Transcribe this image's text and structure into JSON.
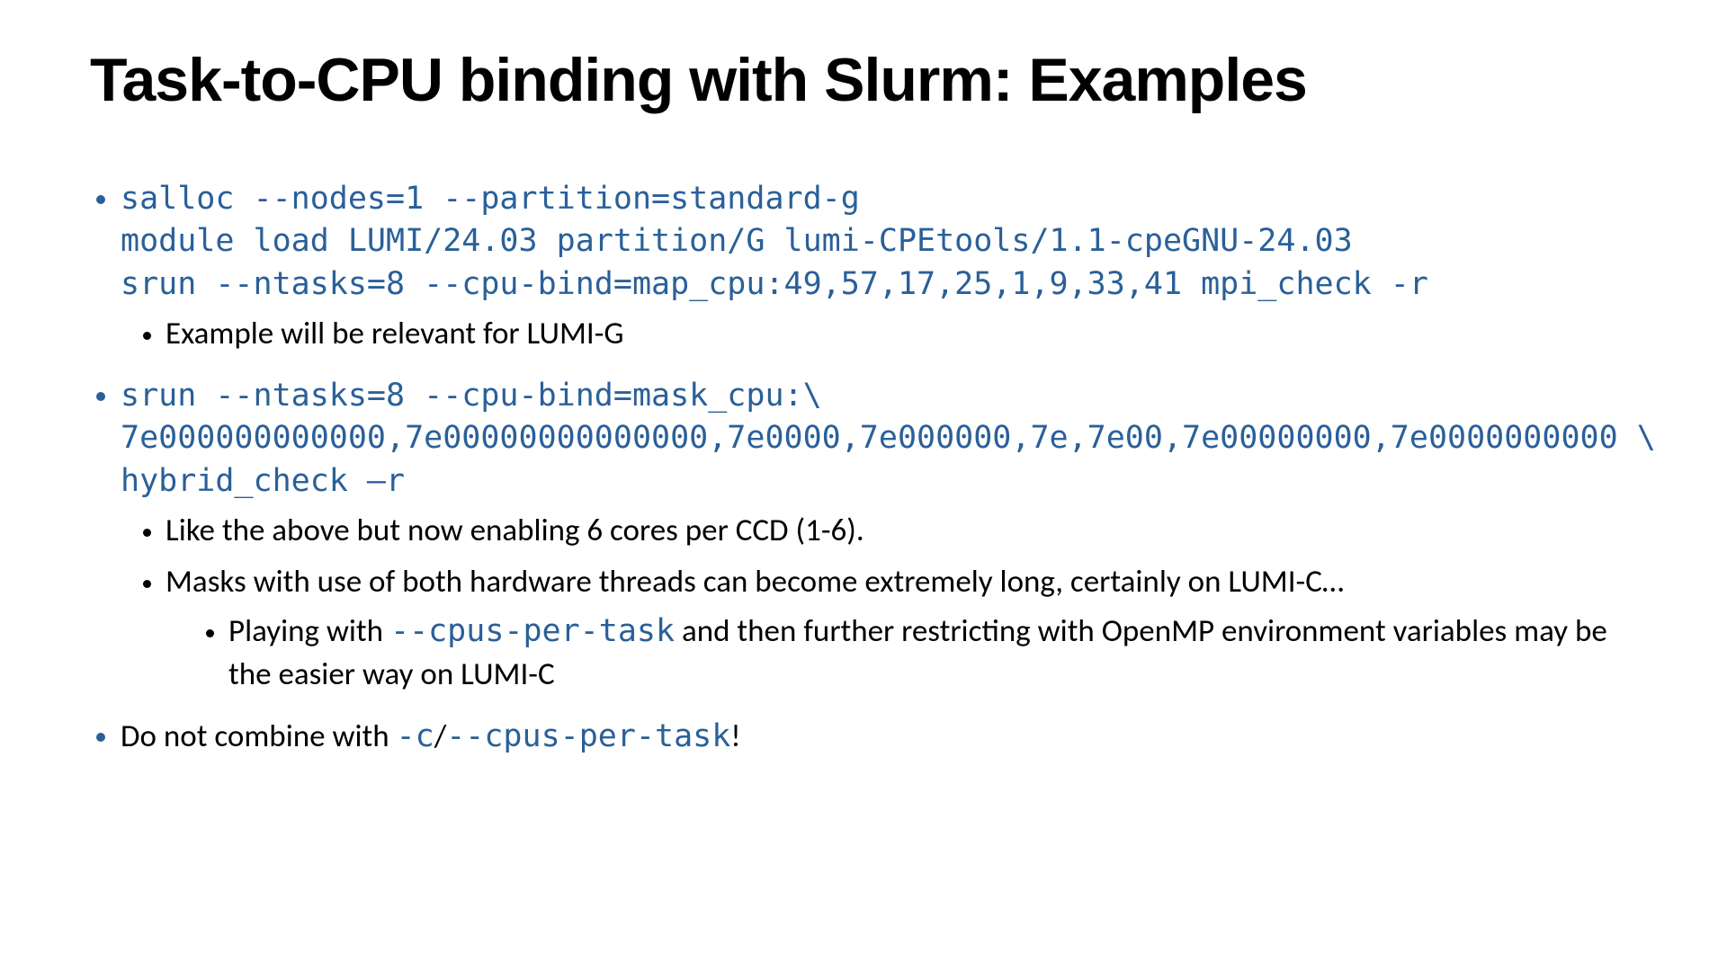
{
  "title": "Task-to-CPU binding with Slurm: Examples",
  "bullets": [
    {
      "code": "salloc --nodes=1 --partition=standard-g\nmodule load LUMI/24.03 partition/G lumi-CPEtools/1.1-cpeGNU-24.03\nsrun --ntasks=8 --cpu-bind=map_cpu:49,57,17,25,1,9,33,41 mpi_check -r",
      "sub": [
        {
          "text": "Example will be relevant for LUMI-G"
        }
      ]
    },
    {
      "code": "srun --ntasks=8 --cpu-bind=mask_cpu:\\\n7e000000000000,7e00000000000000,7e0000,7e000000,7e,7e00,7e00000000,7e0000000000 \\\nhybrid_check –r",
      "sub": [
        {
          "text": "Like the above but now enabling 6 cores per CCD (1-6)."
        },
        {
          "text": "Masks with use of both hardware threads can become extremely long, certainly on LUMI-C…",
          "sub3": [
            {
              "pre": "Playing with ",
              "code": "--cpus-per-task",
              "post": " and then further restricting with OpenMP environment variables may be the easier way on LUMI-C"
            }
          ]
        }
      ]
    },
    {
      "plain_pre": "Do not combine with ",
      "code_inline1": "-c",
      "plain_mid": "/",
      "code_inline2": "--cpus-per-task",
      "plain_post": "!"
    }
  ]
}
